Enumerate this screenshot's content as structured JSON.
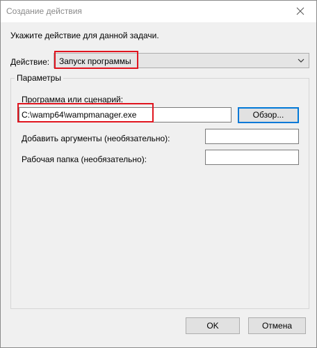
{
  "window": {
    "title": "Создание действия"
  },
  "instruction": "Укажите действие для данной задачи.",
  "action": {
    "label": "Действие:",
    "value": "Запуск программы"
  },
  "params": {
    "legend": "Параметры",
    "program_label": "Программа или сценарий:",
    "program_value": "C:\\wamp64\\wampmanager.exe",
    "browse_label": "Обзор...",
    "args_label": "Добавить аргументы (необязательно):",
    "args_value": "",
    "workdir_label": "Рабочая папка (необязательно):",
    "workdir_value": ""
  },
  "footer": {
    "ok_label": "OK",
    "cancel_label": "Отмена"
  },
  "colors": {
    "highlight": "#e0141e",
    "focus": "#0078d7"
  },
  "icons": {
    "close": "close-icon",
    "dropdown": "chevron-down-icon"
  }
}
